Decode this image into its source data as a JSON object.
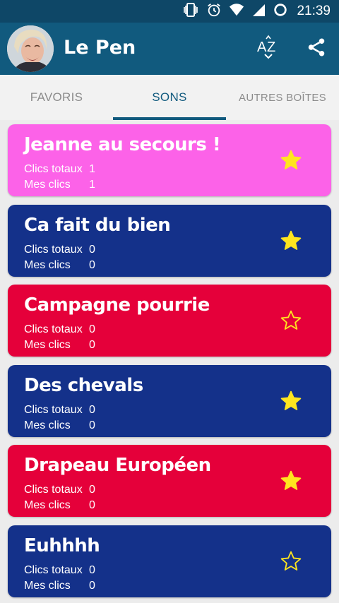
{
  "status_bar": {
    "time": "21:39"
  },
  "app_bar": {
    "title": "Le Pen"
  },
  "tabs": [
    {
      "label": "FAVORIS",
      "selected": false
    },
    {
      "label": "SONS",
      "selected": true
    },
    {
      "label": "AUTRES BOÎTES",
      "selected": false
    }
  ],
  "stats_labels": {
    "total": "Clics totaux",
    "mine": "Mes clics"
  },
  "sounds": [
    {
      "title": "Jeanne au secours !",
      "total": "1",
      "mine": "1",
      "favorite": true,
      "color": "#fc62e8"
    },
    {
      "title": "Ca fait du bien",
      "total": "0",
      "mine": "0",
      "favorite": true,
      "color": "#14318a"
    },
    {
      "title": "Campagne pourrie",
      "total": "0",
      "mine": "0",
      "favorite": false,
      "color": "#e5003a"
    },
    {
      "title": "Des chevals",
      "total": "0",
      "mine": "0",
      "favorite": true,
      "color": "#14318a"
    },
    {
      "title": "Drapeau Européen",
      "total": "0",
      "mine": "0",
      "favorite": true,
      "color": "#e5003a"
    },
    {
      "title": "Euhhhh",
      "total": "0",
      "mine": "0",
      "favorite": false,
      "color": "#14318a"
    }
  ],
  "colors": {
    "status_bar": "#0e4767",
    "app_bar": "#115a7e",
    "tab_selected": "#115a7e",
    "tab_unselected": "#8c8c8c",
    "star": "#ffe51f"
  }
}
